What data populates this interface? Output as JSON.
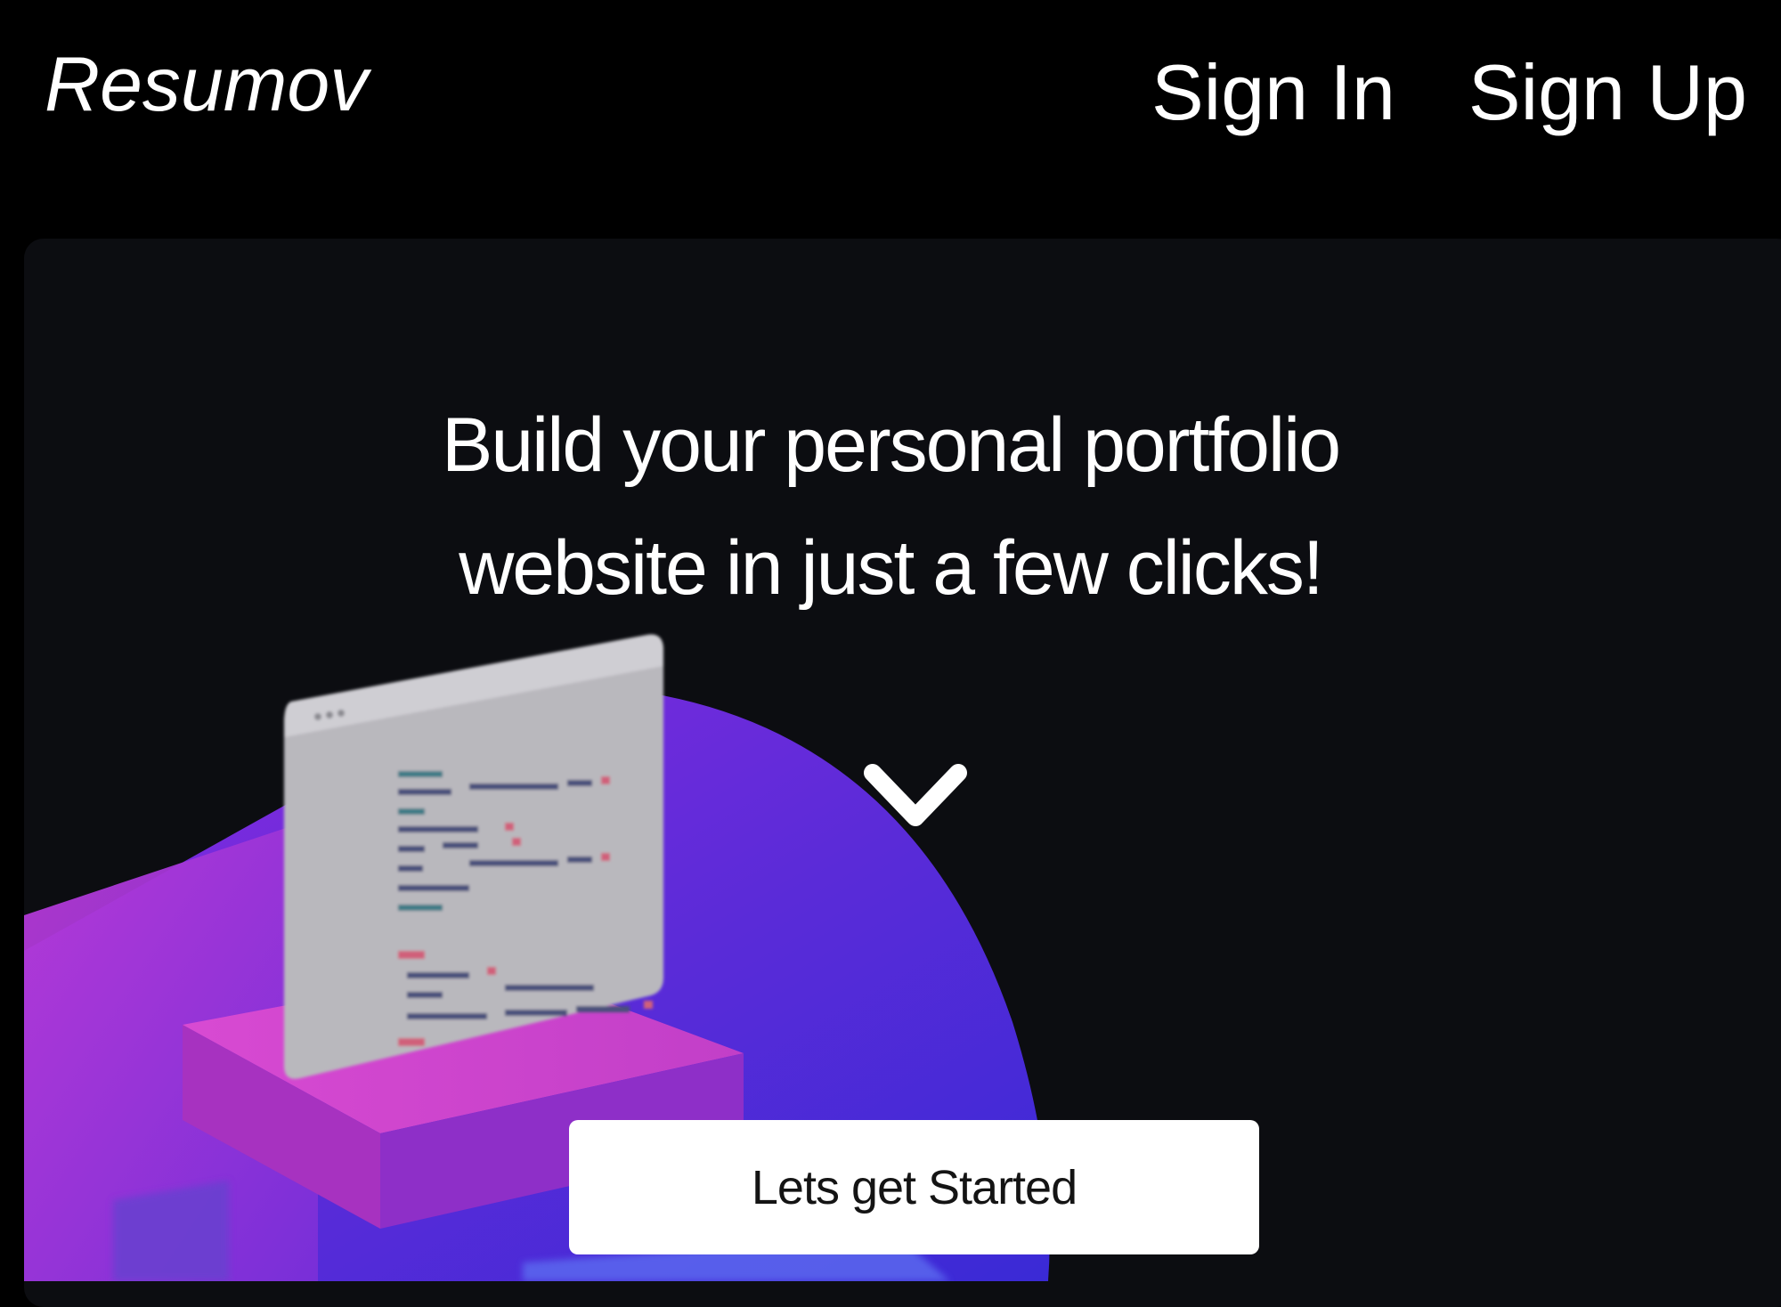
{
  "navbar": {
    "brand": "Resumov",
    "links": [
      {
        "label": "Sign In"
      },
      {
        "label": "Sign Up"
      }
    ]
  },
  "hero": {
    "headline_line1": "Build your personal portfolio",
    "headline_line2": "website in just a few clicks!",
    "scroll_icon": "chevron-down-icon",
    "illustration": "code-editor-laptop-illustration",
    "cta_label": "Lets get Started"
  },
  "colors": {
    "page_background": "#000000",
    "hero_background": "#0c0d11",
    "text": "#ffffff",
    "blob_purple": "#7b2be0",
    "blob_blue": "#3b2ad8",
    "panel_pink": "#c640c8",
    "editor_gray": "#bdbdc2",
    "cta_background": "#ffffff",
    "cta_text": "#141414"
  }
}
